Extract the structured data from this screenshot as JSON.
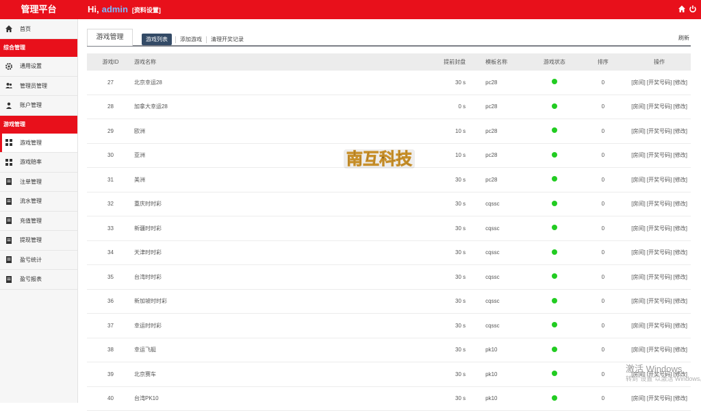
{
  "header": {
    "brand": "管理平台",
    "greeting": "Hi,",
    "username": "admin",
    "settings_link": "[资料设置]"
  },
  "sidebar": {
    "home": "首页",
    "section1": "综合管理",
    "group1": [
      {
        "label": "通用设置",
        "icon": "gear-icon"
      },
      {
        "label": "管理员管理",
        "icon": "users-icon"
      },
      {
        "label": "账户管理",
        "icon": "user-icon"
      }
    ],
    "section2": "游戏管理",
    "group2": [
      {
        "label": "游戏管理",
        "icon": "grid-icon"
      },
      {
        "label": "游戏赔率",
        "icon": "grid-icon"
      },
      {
        "label": "注单管理",
        "icon": "doc-icon"
      },
      {
        "label": "流水管理",
        "icon": "doc-icon"
      },
      {
        "label": "充值管理",
        "icon": "doc-icon"
      },
      {
        "label": "提现管理",
        "icon": "doc-icon"
      },
      {
        "label": "盈亏统计",
        "icon": "doc-icon"
      },
      {
        "label": "盈亏报表",
        "icon": "doc-icon"
      }
    ]
  },
  "main": {
    "page_tab": "游戏管理",
    "subtabs": [
      "游戏列表",
      "添加游戏",
      "清理开奖记录"
    ],
    "refresh": "刷新",
    "columns": [
      "游戏ID",
      "游戏名称",
      "提前封盘",
      "模板名称",
      "游戏状态",
      "排序",
      "操作"
    ],
    "op_links": "[房间] [开奖号码] [修改]",
    "rows": [
      {
        "id": "27",
        "name": "北京幸运28",
        "close": "30 s",
        "tpl": "pc28",
        "sort": "0"
      },
      {
        "id": "28",
        "name": "加拿大幸运28",
        "close": "0 s",
        "tpl": "pc28",
        "sort": "0"
      },
      {
        "id": "29",
        "name": "欧洲",
        "close": "10 s",
        "tpl": "pc28",
        "sort": "0"
      },
      {
        "id": "30",
        "name": "亚洲",
        "close": "10 s",
        "tpl": "pc28",
        "sort": "0"
      },
      {
        "id": "31",
        "name": "美洲",
        "close": "30 s",
        "tpl": "pc28",
        "sort": "0"
      },
      {
        "id": "32",
        "name": "重庆时时彩",
        "close": "30 s",
        "tpl": "cqssc",
        "sort": "0"
      },
      {
        "id": "33",
        "name": "新疆时时彩",
        "close": "30 s",
        "tpl": "cqssc",
        "sort": "0"
      },
      {
        "id": "34",
        "name": "天津时时彩",
        "close": "30 s",
        "tpl": "cqssc",
        "sort": "0"
      },
      {
        "id": "35",
        "name": "台湾时时彩",
        "close": "30 s",
        "tpl": "cqssc",
        "sort": "0"
      },
      {
        "id": "36",
        "name": "新加坡时时彩",
        "close": "30 s",
        "tpl": "cqssc",
        "sort": "0"
      },
      {
        "id": "37",
        "name": "幸运时时彩",
        "close": "30 s",
        "tpl": "cqssc",
        "sort": "0"
      },
      {
        "id": "38",
        "name": "幸运飞艇",
        "close": "30 s",
        "tpl": "pk10",
        "sort": "0"
      },
      {
        "id": "39",
        "name": "北京赛车",
        "close": "30 s",
        "tpl": "pk10",
        "sort": "0"
      },
      {
        "id": "40",
        "name": "台湾PK10",
        "close": "30 s",
        "tpl": "pk10",
        "sort": "0"
      }
    ]
  },
  "watermark_logo": "南互科技",
  "windows_activation": {
    "line1": "激活 Windows",
    "line2": "转到\"设置\"以激活 Windows。"
  },
  "colors": {
    "brand_red": "#e8101b",
    "status_green": "#22cc22",
    "tab_active": "#334a66"
  }
}
